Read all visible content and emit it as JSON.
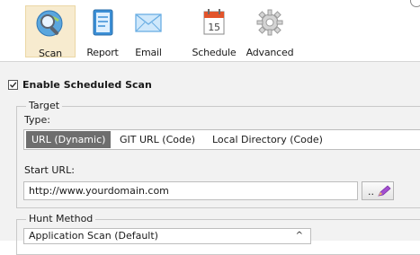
{
  "toolbar": {
    "items": [
      {
        "label": "Scan",
        "icon": "scan-magnifier-icon",
        "active": true
      },
      {
        "label": "Report",
        "icon": "report-notebook-icon"
      },
      {
        "label": "Email",
        "icon": "email-envelope-icon"
      },
      {
        "label": "Schedule",
        "icon": "calendar-icon",
        "calendar_day": "15"
      },
      {
        "label": "Advanced",
        "icon": "gear-icon"
      }
    ]
  },
  "scheduled": {
    "label": "Enable Scheduled Scan",
    "checked": true
  },
  "target": {
    "title": "Target",
    "type_label": "Type:",
    "types": [
      "URL (Dynamic)",
      "GIT URL (Code)",
      "Local Directory (Code)"
    ],
    "selected_type": "URL (Dynamic)",
    "start_url_label": "Start URL:",
    "start_url_value": "http://www.yourdomain.com",
    "browse_label": ".."
  },
  "hunt": {
    "title": "Hunt Method",
    "selected": "Application Scan (Default)"
  },
  "colors": {
    "active_tab_bg": "#f7ebcf",
    "selected_segment": "#6e6e6e",
    "panel_bg": "#f2f2f2",
    "pencil_accent": "#a34fd0"
  }
}
